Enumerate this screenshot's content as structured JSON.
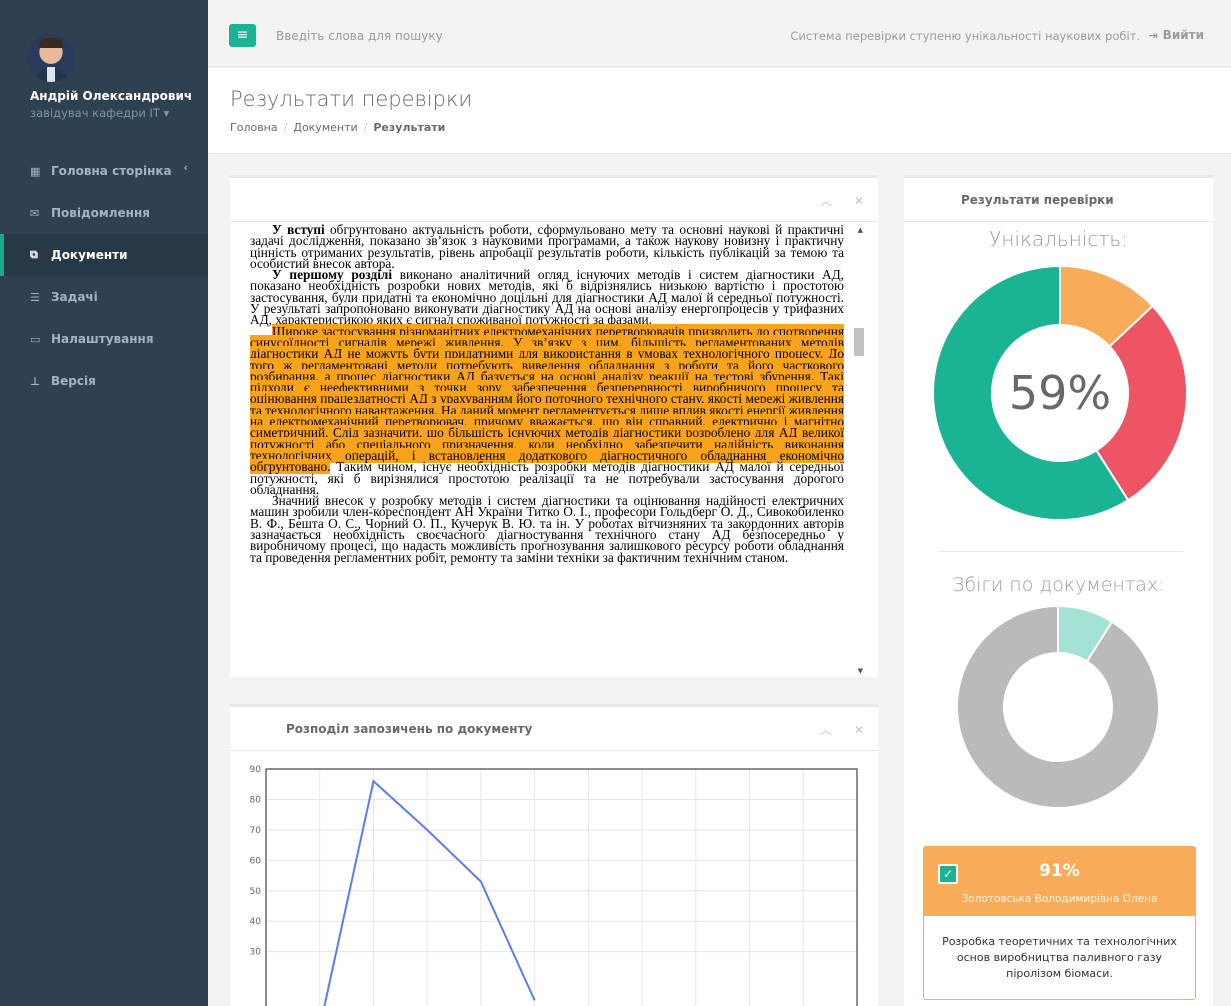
{
  "profile": {
    "name": "Андрій Олександрович",
    "role": "завідувач кафедри IT ▾"
  },
  "nav": [
    {
      "label": "Головна сторінка",
      "icon": "th-large-icon"
    },
    {
      "label": "Повідомлення",
      "icon": "envelope-icon"
    },
    {
      "label": "Документи",
      "icon": "files-icon"
    },
    {
      "label": "Задачі",
      "icon": "tasks-icon"
    },
    {
      "label": "Налаштування",
      "icon": "desktop-icon"
    },
    {
      "label": "Версія",
      "icon": "sitemap-icon"
    }
  ],
  "topbar": {
    "search_placeholder": "Введіть слова для пошуку",
    "system_title": "Система перевірки ступеню унікальності наукових робіт.",
    "logout": "Вийти"
  },
  "heading": {
    "title": "Результати перевірки",
    "breadcrumb": [
      "Головна",
      "Документи",
      "Результати"
    ]
  },
  "document": {
    "paragraphs": [
      {
        "bold": "У вступі",
        "text": " обгрунтовано актуальність роботи, сформульовано мету та основні наукові й практичні задачі дослідження, показано зв’язок з науковими програмами, а також наукову новизну і практичну цінність отриманих результатів, рівень апробації результатів роботи, кількість публікацій за темою та особистий внесок автора."
      },
      {
        "bold": "У першому розділі",
        "text": " виконано аналітичний огляд існуючих методів і систем діагностики АД, показано необхідність розробки нових методів, які б відрізнялись низькою вартістю і простотою застосування, були придатні та економічно доцільні для діагностики АД малої й середньої потужності. У результаті запропоновано виконувати діагностику АД на основі аналізу енергопроцесів у трифазних АД, характеристикою яких є сигнал споживаної потужності за фазами."
      },
      {
        "highlight": "Широке застосування різноманітних електромеханічних перетворювачів призводить до спотворення синусоїдності сигналів мережі живлення. У зв’язку з цим, більшість регламентованих методів діагностики АД не можуть бути придатними для використання в умовах технологічного процесу. До того ж регламентовані методи потребують виведення обладнання з роботи та його часткового розбирання, а процес діагностики АД базується на основі аналізу реакції на тестові збурення. Такі підходи є неефективними з точки зору забезпечення безперервності виробничого процесу та оцінювання працездатності АД з урахуванням його поточного технічного стану, якості мережі живлення та технологічного навантаження. На даний момент регламентується лише вплив якості енергії живлення на електромеханічний перетворювач, причому вважається, що він справний, електрично і магнітно симетричний. Слід зазначити, що більшість існуючих методів діагностики розроблено для АД великої потужності або спеціального призначення, коли необхідно забезпечити надійність виконання технологічних операцій, і встановлення додаткового діагностичного обладнання економічно обгрунтовано.",
        "text": " Таким чином, існує необхідність розробки методів діагностики АД малої й середньої потужності, які б вирізнялися простотою реалізації та не потребували застосування дорогого обладнання."
      },
      {
        "text": "Значний внесок у розробку методів і систем діагностики та оцінювання надійності електричних машин зробили член-кореспондент АН України Титко О. І., професори Гольдберг О. Д., Сивокобиленко В. Ф., Бешта О. С., Чорний О. П., Кучерук В. Ю. та ін. У роботах вітчизняних та закордонних авторів зазначається необхідність своєчасного діагностування технічного стану АД безпосередньо у виробничому процесі, що надасть можливість прогнозування залишкового ресурсу роботи обладнання та проведення регламентних робіт, ремонту та заміни техніки за фактичним технічним станом."
      }
    ]
  },
  "chart_panel": {
    "title": "Розподіл запозичень по документу"
  },
  "chart_data": {
    "type": "line",
    "x": [
      0,
      1,
      2,
      3,
      4,
      5,
      6,
      7,
      8,
      9,
      10,
      11
    ],
    "series": [
      {
        "values": [
          null,
          5,
          86,
          70,
          53,
          14,
          null,
          null,
          null,
          null,
          null,
          null
        ]
      }
    ],
    "yticks": [
      30,
      40,
      50,
      60,
      70,
      80,
      90
    ],
    "ylim": [
      0,
      90
    ],
    "color": "#5b7cf0"
  },
  "results": {
    "title": "Результати перевірки",
    "uniqueness_label": "Унікальність:",
    "uniqueness_value": "59%",
    "uniqueness_slices": [
      {
        "value": 59,
        "color": "#1ab394"
      },
      {
        "value": 28,
        "color": "#ed5565"
      },
      {
        "value": 13,
        "color": "#f8ac59"
      }
    ],
    "matches_label": "Збіги по документах:",
    "matches_slices": [
      {
        "value": 91,
        "color": "#bababa"
      },
      {
        "value": 9,
        "color": "#a3e1d4"
      }
    ],
    "match": {
      "percent": "91%",
      "author": "Золотовська Володимирівна Олена",
      "title": "Розробка теоретичних та технологічних основ виробництва паливного газу піролізом біомаси."
    }
  }
}
